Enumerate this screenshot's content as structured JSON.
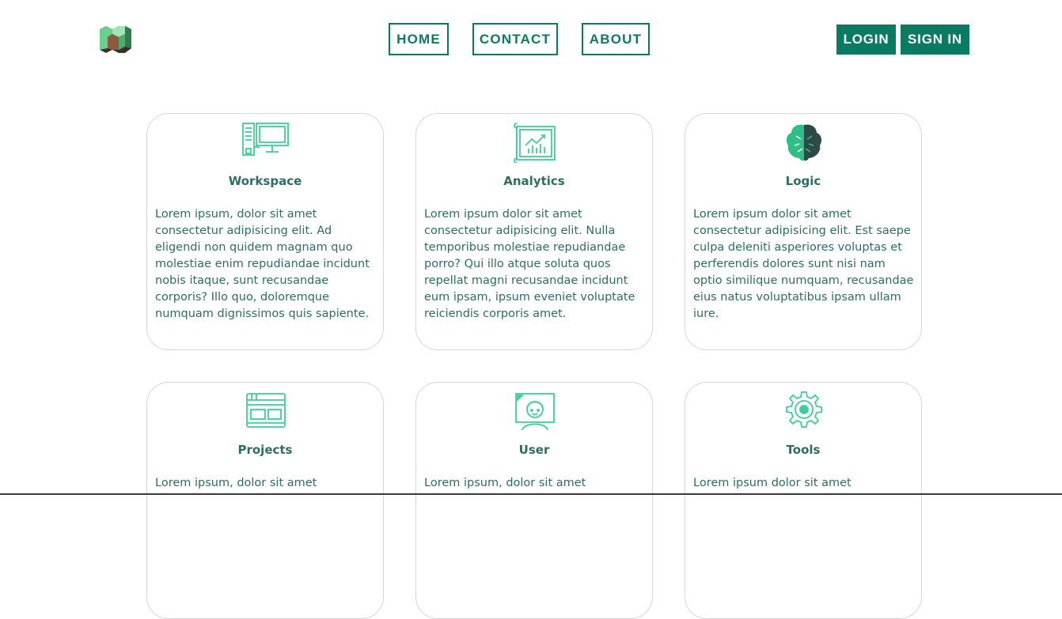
{
  "header": {
    "logo_icon": "minecraft-block-logo-icon",
    "nav": {
      "home": "HOME",
      "contact": "CONTACT",
      "about": "ABOUT"
    },
    "auth": {
      "login": "LOGIN",
      "signin": "SIGN IN"
    }
  },
  "colors": {
    "accent": "#0b7a62",
    "text": "#2c6e62",
    "icon_light": "#3ccf9a",
    "card_border": "#d6d6d6"
  },
  "cards": [
    {
      "title": "Workspace",
      "icon": "workspace-computer-icon",
      "text": "Lorem ipsum, dolor sit amet consectetur adipisicing elit. Ad eligendi non quidem magnam quo molestiae enim repudiandae incidunt nobis itaque, sunt recusandae corporis? Illo quo, doloremque numquam dignissimos quis sapiente."
    },
    {
      "title": "Analytics",
      "icon": "analytics-chart-icon",
      "text": "Lorem ipsum dolor sit amet consectetur adipisicing elit. Nulla temporibus molestiae repudiandae porro? Qui illo atque soluta quos repellat magni recusandae incidunt eum ipsam, ipsum eveniet voluptate reiciendis corporis amet."
    },
    {
      "title": "Logic",
      "icon": "brain-icon",
      "text": "Lorem ipsum dolor sit amet consectetur adipisicing elit. Est saepe culpa deleniti asperiores voluptas et perferendis dolores sunt nisi nam optio similique numquam, recusandae eius natus voluptatibus ipsam ullam iure."
    },
    {
      "title": "Projects",
      "icon": "projects-window-icon",
      "text": "Lorem ipsum, dolor sit amet"
    },
    {
      "title": "User",
      "icon": "user-avatar-icon",
      "text": "Lorem ipsum, dolor sit amet"
    },
    {
      "title": "Tools",
      "icon": "gear-icon",
      "text": "Lorem ipsum dolor sit amet"
    }
  ]
}
